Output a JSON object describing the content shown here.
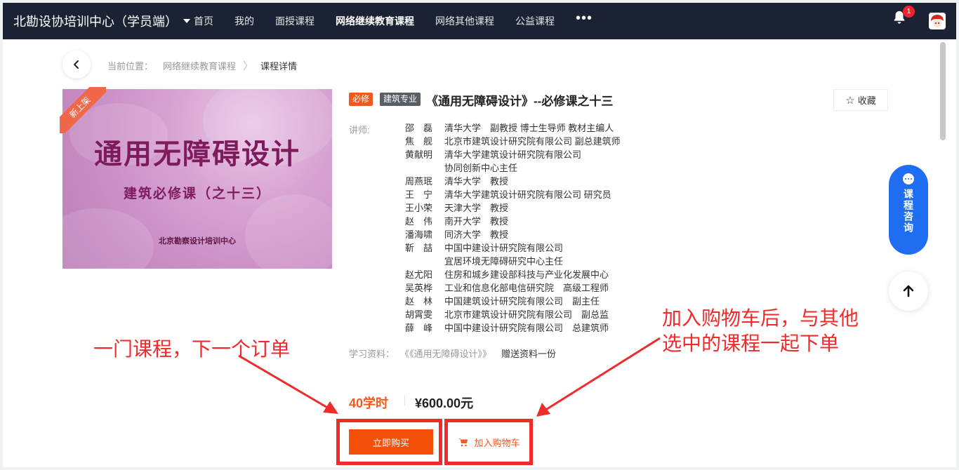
{
  "header": {
    "brand": "北勘设协培训中心（学员端）",
    "nav": [
      "首页",
      "我的",
      "面授课程",
      "网络继续教育课程",
      "网络其他课程",
      "公益课程"
    ],
    "active_index": 3,
    "more": "•••",
    "notification_count": "1"
  },
  "breadcrumb": {
    "label": "当前位置：",
    "items": [
      "网络继续教育课程",
      "课程详情"
    ]
  },
  "cover": {
    "ribbon": "新上架",
    "title": "通用无障碍设计",
    "subtitle": "建筑必修课（之十三）",
    "org": "北京勘察设计培训中心"
  },
  "course": {
    "tag_required": "必修",
    "tag_category": "建筑专业",
    "title": "《通用无障碍设计》--必修课之十三",
    "favorite": "收藏",
    "lecturer_label": "讲师:",
    "lecturers": [
      {
        "name": "邵　磊",
        "desc": "清华大学　副教授 博士生导师 教材主编人"
      },
      {
        "name": "焦　舰",
        "desc": "北京市建筑设计研究院有限公司 副总建筑师"
      },
      {
        "name": "黄献明",
        "desc": "清华大学建筑设计研究院有限公司"
      },
      {
        "name": "",
        "desc": "协同创新中心主任"
      },
      {
        "name": "周燕珉",
        "desc": "清华大学　教授"
      },
      {
        "name": "王　宁",
        "desc": "清华大学建筑设计研究院有限公司 研究员"
      },
      {
        "name": "王小荣",
        "desc": "天津大学　教授"
      },
      {
        "name": "赵　伟",
        "desc": "南开大学　教授"
      },
      {
        "name": "潘海啸",
        "desc": "同济大学　教授"
      },
      {
        "name": "靳　喆",
        "desc": "中国中建设计研究院有限公司"
      },
      {
        "name": "",
        "desc": "宜居环境无障碍研究中心主任"
      },
      {
        "name": "赵尤阳",
        "desc": "住房和城乡建设部科技与产业化发展中心"
      },
      {
        "name": "吴英桦",
        "desc": "工业和信息化部电信研究院　高级工程师"
      },
      {
        "name": "赵　林",
        "desc": "中国建筑设计研究院有限公司　副主任"
      },
      {
        "name": "胡霄雯",
        "desc": "北京市建筑设计研究院有限公司　副总监"
      },
      {
        "name": "薛　峰",
        "desc": "中国中建设计研究院有限公司　总建筑师"
      }
    ],
    "material_label": "学习资料：",
    "material_name": "《《通用无障碍设计》》",
    "material_note": "赠送资料一份",
    "hours": "40学时",
    "price": "¥600.00元",
    "buy_now": "立即购买",
    "add_cart": "加入购物车"
  },
  "side": {
    "consult": "课程咨询"
  },
  "annotations": {
    "left": "一门课程，下一个订单",
    "right_line1": "加入购物车后，与其他",
    "right_line2": "选中的课程一起下单"
  },
  "colors": {
    "topbar": "#1a2233",
    "accent": "#f05a1e",
    "annotation": "#f02b2b",
    "consult": "#1f6ef2"
  }
}
